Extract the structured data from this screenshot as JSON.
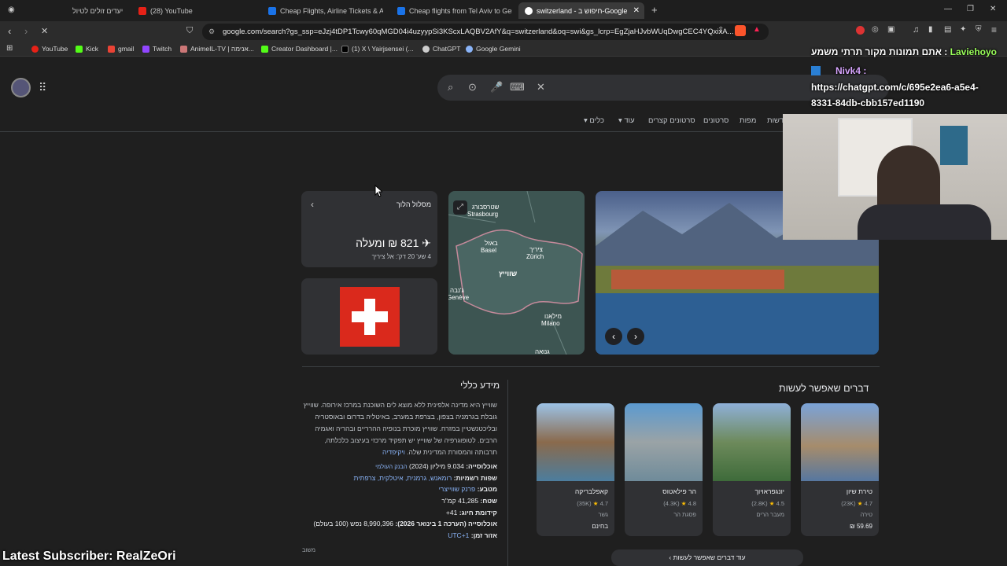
{
  "tabs": [
    {
      "title": "יעדים זולים לטיול"
    },
    {
      "title": "(28) YouTube"
    },
    {
      "title": "Cheap Flights, Airline Tickets & Airfa"
    },
    {
      "title": "Cheap flights from Tel Aviv to Geneva"
    },
    {
      "title": "switzerland - חיפוש ב-Google"
    }
  ],
  "address": {
    "url": "google.com/search?gs_ssp=eJzj4tDP1Tcwy60qMGD04i4uzyypSi3KScxLAQBV2AfY&q=switzerland&oq=swi&gs_lcrp=EgZjaHJvbWUqDwgCEC4YQxixA..."
  },
  "bookmarks": [
    "YouTube",
    "Kick",
    "gmail",
    "Twitch",
    "AnimeIL-TV | אנימה...",
    "Creator Dashboard |...",
    "(1) X \\ Yairjsensei (...",
    "ChatGPT",
    "Google Gemini"
  ],
  "chips": [
    "כלים",
    "עוד",
    "סרטונים קצרים",
    "סרטונים",
    "מפות",
    "חדשות"
  ],
  "flight_card": {
    "title": "מסלול הלוך",
    "price": "821 ₪ ומעלה",
    "details": "4 שע' 20 דק': אל ציריך"
  },
  "map": {
    "labels": [
      "שטרסבורג",
      "Strasbourg",
      "באזל",
      "Basel",
      "ציריך",
      "Zürich",
      "שווייץ",
      "ג'נבה",
      "Genève",
      "מילאנו",
      "Milano",
      "גנואה"
    ]
  },
  "general_info": {
    "heading": "מידע כללי",
    "description": "שווייץ היא מדינה אלפינית ללא מוצא לים השוכנת במרכז אירופה. שווייץ גובלת בגרמניה בצפון, בצרפת במערב, באיטליה בדרום ובאוסטריה ובליכטנשטיין במזרח. שווייץ מוכרת בנופיה ההרריים ובהריה ואגמיה הרבים. לטופוגרפיה של שווייץ יש תפקיד מרכזי בעיצוב כלכלתה, תרבותה והמסורת המדינית שלה.",
    "wiki_link": "ויקיפדיה",
    "rows": [
      {
        "label": "אוכלוסייה:",
        "value": "9.034 מיליון (2024)",
        "link": "הבנק העולמי"
      },
      {
        "label": "שפות רשמיות:",
        "value": "",
        "link": "רומאנש, גרמנית, איטלקית, צרפתית"
      },
      {
        "label": "מטבע:",
        "value": "",
        "link": "פרנק שווייצרי"
      },
      {
        "label": "שטח:",
        "value": "41,285 קמ\"ר",
        "link": ""
      },
      {
        "label": "קידומת חיוג:",
        "value": "41+",
        "link": ""
      },
      {
        "label": "אוכלוסייה (הערכה 1 בינואר 2026):",
        "value": "8,990,396 נפש (100 בעולם)",
        "link": ""
      },
      {
        "label": "אזור זמן:",
        "value": "",
        "link": "UTC+1"
      }
    ],
    "feedback": "משוב"
  },
  "things_to_do": {
    "heading": "דברים שאפשר לעשות",
    "more_button": "עוד דברים שאפשר לעשות",
    "items": [
      {
        "name": "טירת שיון",
        "rating": "4.7",
        "reviews": "(23K)",
        "sub": "טירה",
        "extra": "59.69 ₪"
      },
      {
        "name": "יונגפראויוך",
        "rating": "4.5",
        "reviews": "(2.8K)",
        "sub": "מעבר הרים",
        "extra": ""
      },
      {
        "name": "הר פילאטוס",
        "rating": "4.8",
        "reviews": "(4.3K)",
        "sub": "פסגת הר",
        "extra": ""
      },
      {
        "name": "קאפלבריקה",
        "rating": "4.7",
        "reviews": "(35K)",
        "sub": "גשר",
        "extra": "בחינם"
      }
    ]
  },
  "stream": {
    "chat_line1_user": "Laviehoyo",
    "chat_line1_text": ": אתם תמונות מקור תרתי משמע",
    "chat_line2_user": "Nivk4 :",
    "chat_line2_text": "https://chatgpt.com/c/695e2ea6-a5e4-",
    "chat_line3_text": "8331-84db-cbb157ed1190",
    "latest_subscriber": "Latest Subscriber: RealZeOri"
  }
}
